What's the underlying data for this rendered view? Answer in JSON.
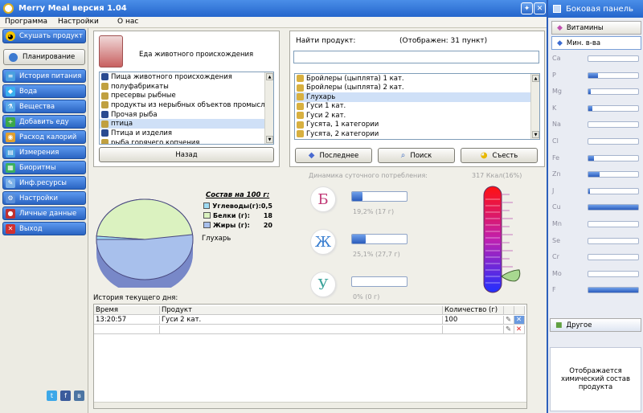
{
  "window": {
    "title": "Merry Meal версия 1.04"
  },
  "menu": [
    "Программа",
    "Настройки",
    "О нас"
  ],
  "nav": {
    "top_button": "Скушать продукт",
    "plan_button": "Планирование",
    "items": [
      "История питания",
      "Вода",
      "Вещества",
      "Добавить еду",
      "Расход калорий",
      "Измерения",
      "Биоритмы",
      "Инф.ресурсы",
      "Настройки",
      "Личные данные",
      "Выход"
    ]
  },
  "category": {
    "title": "Еда животного происхождения",
    "items": [
      "Пища животного происхождения",
      "полуфабрикаты",
      "пресервы рыбные",
      "продукты из нерыбных объектов промысла",
      "Прочая рыба",
      "птица",
      "Птица и изделия",
      "рыба горячего копчения"
    ],
    "selected": "птица",
    "back_button": "Назад"
  },
  "search": {
    "label": "Найти продукт:",
    "count": "(Отображен: 31 пункт)",
    "value": "",
    "products": [
      "Бройлеры (цыплята) 1 кат.",
      "Бройлеры (цыплята) 2 кат.",
      "Глухарь",
      "Гуси 1 кат.",
      "Гуси 2 кат.",
      "Гусята, 1 категории",
      "Гусята, 2 категории"
    ],
    "selected": "Глухарь",
    "btn_last": "Последнее",
    "btn_search": "Поиск",
    "btn_eat": "Съесть"
  },
  "composition": {
    "title": "Состав на 100 г:",
    "rows": [
      {
        "label": "Углеводы(г):",
        "value": "0,5",
        "color": "#9fdbf3"
      },
      {
        "label": "Белки (г):",
        "value": "18",
        "color": "#dbf2c0"
      },
      {
        "label": "Жиры (г):",
        "value": "20",
        "color": "#a8c0ec"
      }
    ],
    "product": "Глухарь"
  },
  "daily": {
    "title": "Динамика суточного потребления:",
    "kcal": "317 Ккал(16%)",
    "kcal_fraction": 0.16,
    "items": [
      {
        "letter": "Б",
        "text": "19,2% (17 г)",
        "fraction": 0.192,
        "color": "#c23a77"
      },
      {
        "letter": "Ж",
        "text": "25,1% (27,7 г)",
        "fraction": 0.251,
        "color": "#3a7fd0"
      },
      {
        "letter": "У",
        "text": "0% (0 г)",
        "fraction": 0.0,
        "color": "#3aa39a"
      }
    ]
  },
  "history": {
    "title": "История текущего дня:",
    "headers": [
      "Время",
      "Продукт",
      "Количество (г)"
    ],
    "rows": [
      {
        "time": "13:20:57",
        "product": "Гуси 2 кат.",
        "amount": "100"
      }
    ]
  },
  "social": [
    "t",
    "f",
    "в"
  ],
  "side": {
    "title": "Боковая панель",
    "tab_vitamins": "Витамины",
    "tab_minerals": "Мин. в-ва",
    "tab_other": "Другое",
    "minerals": [
      {
        "name": "Ca",
        "fraction": 0.0
      },
      {
        "name": "P",
        "fraction": 0.2
      },
      {
        "name": "Mg",
        "fraction": 0.05
      },
      {
        "name": "K",
        "fraction": 0.08
      },
      {
        "name": "Na",
        "fraction": 0.0
      },
      {
        "name": "Cl",
        "fraction": 0.0
      },
      {
        "name": "Fe",
        "fraction": 0.12
      },
      {
        "name": "Zn",
        "fraction": 0.22
      },
      {
        "name": "J",
        "fraction": 0.03
      },
      {
        "name": "Cu",
        "fraction": 1.0
      },
      {
        "name": "Mn",
        "fraction": 0.0
      },
      {
        "name": "Se",
        "fraction": 0.0
      },
      {
        "name": "Cr",
        "fraction": 0.0
      },
      {
        "name": "Mo",
        "fraction": 0.0
      },
      {
        "name": "F",
        "fraction": 1.0
      }
    ],
    "info": "Отображается химический состав продукта"
  }
}
